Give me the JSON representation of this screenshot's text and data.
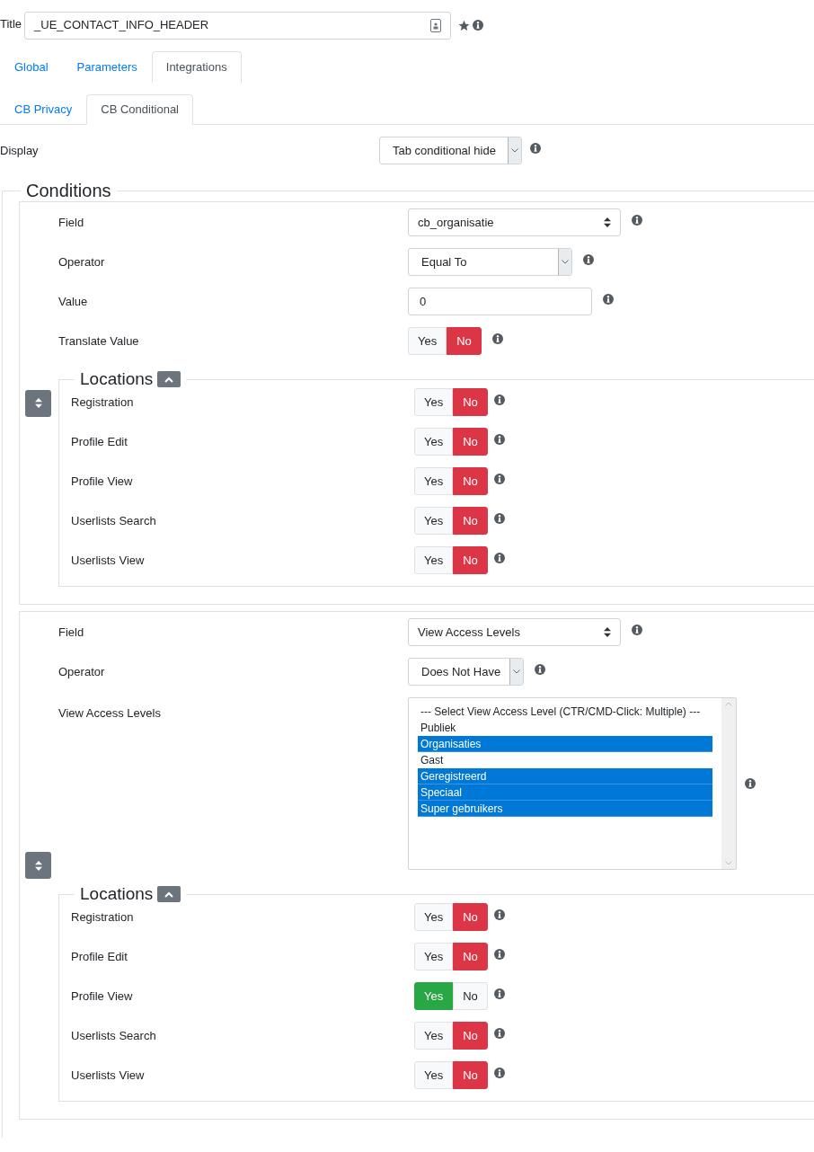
{
  "title_field": {
    "label": "Title",
    "value": "_UE_CONTACT_INFO_HEADER"
  },
  "tabs": [
    {
      "label": "Global",
      "selected": false
    },
    {
      "label": "Parameters",
      "selected": false
    },
    {
      "label": "Integrations",
      "selected": true
    }
  ],
  "subtabs": [
    {
      "label": "CB Privacy",
      "selected": false
    },
    {
      "label": "CB Conditional",
      "selected": true
    }
  ],
  "display": {
    "label": "Display",
    "value": "Tab conditional hide"
  },
  "conditions": {
    "legend": "Conditions",
    "items": [
      {
        "rows": [
          {
            "kind": "select",
            "label": "Field",
            "value": "cb_organisatie"
          },
          {
            "kind": "dropdown",
            "label": "Operator",
            "value": "Equal To"
          },
          {
            "kind": "text",
            "label": "Value",
            "value": "0"
          },
          {
            "kind": "toggle",
            "label": "Translate Value",
            "options": [
              {
                "label": "Yes",
                "selected": false
              },
              {
                "label": "No",
                "selected": true
              }
            ]
          }
        ],
        "locations": {
          "legend": "Locations",
          "rows": [
            {
              "label": "Registration",
              "options": [
                {
                  "label": "Yes",
                  "selected": false
                },
                {
                  "label": "No",
                  "selected": true
                }
              ]
            },
            {
              "label": "Profile Edit",
              "options": [
                {
                  "label": "Yes",
                  "selected": false
                },
                {
                  "label": "No",
                  "selected": true
                }
              ]
            },
            {
              "label": "Profile View",
              "options": [
                {
                  "label": "Yes",
                  "selected": false
                },
                {
                  "label": "No",
                  "selected": true
                }
              ]
            },
            {
              "label": "Userlists Search",
              "options": [
                {
                  "label": "Yes",
                  "selected": false
                },
                {
                  "label": "No",
                  "selected": true
                }
              ]
            },
            {
              "label": "Userlists View",
              "options": [
                {
                  "label": "Yes",
                  "selected": false
                },
                {
                  "label": "No",
                  "selected": true
                }
              ]
            }
          ]
        }
      },
      {
        "rows": [
          {
            "kind": "select",
            "label": "Field",
            "value": "View Access Levels"
          },
          {
            "kind": "dropdown",
            "label": "Operator",
            "value": "Does Not Have"
          },
          {
            "kind": "multiselect",
            "label": "View Access Levels",
            "options": [
              {
                "label": "--- Select View Access Level (CTR/CMD-Click: Multiple) ---",
                "selected": false
              },
              {
                "label": "Publiek",
                "selected": false
              },
              {
                "label": "Organisaties",
                "selected": true
              },
              {
                "label": "Gast",
                "selected": false
              },
              {
                "label": "Geregistreerd",
                "selected": true
              },
              {
                "label": "Speciaal",
                "selected": true
              },
              {
                "label": "Super gebruikers",
                "selected": true
              }
            ]
          }
        ],
        "locations": {
          "legend": "Locations",
          "rows": [
            {
              "label": "Registration",
              "options": [
                {
                  "label": "Yes",
                  "selected": false
                },
                {
                  "label": "No",
                  "selected": true
                }
              ]
            },
            {
              "label": "Profile Edit",
              "options": [
                {
                  "label": "Yes",
                  "selected": false
                },
                {
                  "label": "No",
                  "selected": true
                }
              ]
            },
            {
              "label": "Profile View",
              "options": [
                {
                  "label": "Yes",
                  "selected": true
                },
                {
                  "label": "No",
                  "selected": false
                }
              ]
            },
            {
              "label": "Userlists Search",
              "options": [
                {
                  "label": "Yes",
                  "selected": false
                },
                {
                  "label": "No",
                  "selected": true
                }
              ]
            },
            {
              "label": "Userlists View",
              "options": [
                {
                  "label": "Yes",
                  "selected": false
                },
                {
                  "label": "No",
                  "selected": true
                }
              ]
            }
          ]
        }
      }
    ]
  }
}
